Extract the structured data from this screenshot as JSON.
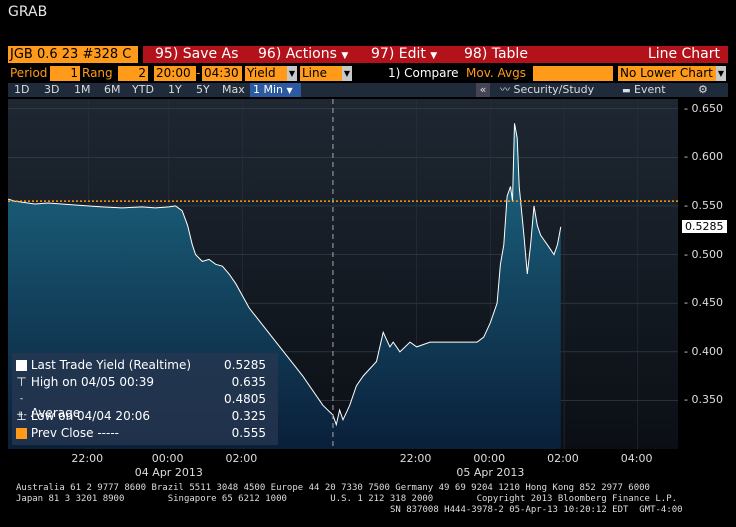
{
  "app": {
    "title": "GRAB"
  },
  "toolbar": {
    "ticker": "JGB 0.6 23 #328 C",
    "save_as": "95) Save As",
    "actions": "96) Actions",
    "edit": "97) Edit",
    "table": "98) Table",
    "chart_type": "Line Chart"
  },
  "params": {
    "period_label": "Period",
    "period_value": "1",
    "range_label": "Rang",
    "range_value": "2",
    "time_from": "20:00",
    "time_to": "04:30",
    "field_value": "Yield",
    "style_value": "Line",
    "compare": "1) Compare",
    "mov_avgs": "Mov. Avgs",
    "lower_chart": "No Lower Chart"
  },
  "periods": {
    "items": [
      "1D",
      "3D",
      "1M",
      "6M",
      "YTD",
      "1Y",
      "5Y",
      "Max"
    ],
    "selected": "1 Min",
    "collapse": "«",
    "security_study": "Security/Study",
    "event": "Event",
    "settings_glyph": "⚙"
  },
  "legend": {
    "last_trade_label": "Last Trade Yield (Realtime)",
    "last_trade_value": "0.5285",
    "high_label": "High on 04/05 00:39",
    "high_value": "0.635",
    "avg_label": "Average",
    "avg_value": "0.4805",
    "low_label": "Low on 04/04 20:06",
    "low_value": "0.325",
    "prev_label": "Prev Close -----",
    "prev_value": "0.555"
  },
  "footer": {
    "line1": "Australia 61 2 9777 8600 Brazil 5511 3048 4500 Europe 44 20 7330 7500 Germany 49 69 9204 1210 Hong Kong 852 2977 6000",
    "line2": "Japan 81 3 3201 8900        Singapore 65 6212 1000        U.S. 1 212 318 2000        Copyright 2013 Bloomberg Finance L.P.",
    "line3": "SN 837008 H444-3978-2 05-Apr-13 10:20:12 EDT  GMT-4:00"
  },
  "colors": {
    "accent_red": "#b3121b",
    "amber": "#ff9a1a",
    "area_top": "#1d6b86",
    "area_bottom": "#0a1f3a",
    "prev_close": "#ff9a1a"
  },
  "chart_data": {
    "type": "area",
    "ylim": [
      0.3,
      0.66
    ],
    "yticks": [
      "0.650",
      "0.600",
      "0.550",
      "0.500",
      "0.450",
      "0.400",
      "0.350"
    ],
    "ytick_values": [
      0.65,
      0.6,
      0.55,
      0.5,
      0.45,
      0.4,
      0.35
    ],
    "last_value_label": "0.5285",
    "last_value": 0.5285,
    "prev_close": 0.555,
    "xticks": [
      {
        "label": "22:00",
        "date": ""
      },
      {
        "label": "00:00",
        "date": "04 Apr 2013"
      },
      {
        "label": "02:00",
        "date": ""
      },
      {
        "label": "22:00",
        "date": ""
      },
      {
        "label": "00:00",
        "date": "05 Apr 2013"
      },
      {
        "label": "02:00",
        "date": ""
      },
      {
        "label": "04:00",
        "date": ""
      }
    ],
    "x_range": [
      0,
      100
    ],
    "xtick_positions": [
      12,
      24,
      35,
      61,
      72,
      83,
      94
    ],
    "session_break": 48.5,
    "series": [
      {
        "x": [
          0,
          1,
          4,
          6,
          8,
          10,
          14,
          17,
          20,
          22,
          24,
          25,
          26,
          26.8,
          27.5,
          28,
          29,
          30,
          31,
          32,
          33,
          34,
          36,
          40,
          44,
          47,
          48.5,
          49,
          49.5,
          50,
          51,
          52,
          53,
          55,
          56,
          57,
          57.5,
          58.5,
          60,
          61,
          63,
          66,
          69,
          70,
          71,
          72,
          73,
          73.5,
          74,
          74.5,
          75,
          75.3,
          75.6,
          76,
          76.3,
          77,
          77.5,
          78,
          78.5,
          79,
          79.5,
          80,
          80.5,
          81,
          81.5,
          82,
          82.5
        ],
        "y": [
          0.557,
          0.555,
          0.552,
          0.553,
          0.552,
          0.551,
          0.549,
          0.548,
          0.549,
          0.548,
          0.549,
          0.55,
          0.545,
          0.53,
          0.51,
          0.5,
          0.493,
          0.495,
          0.49,
          0.488,
          0.48,
          0.47,
          0.445,
          0.41,
          0.375,
          0.345,
          0.335,
          0.325,
          0.34,
          0.33,
          0.345,
          0.365,
          0.375,
          0.39,
          0.42,
          0.405,
          0.41,
          0.4,
          0.41,
          0.405,
          0.41,
          0.41,
          0.41,
          0.41,
          0.415,
          0.43,
          0.45,
          0.49,
          0.51,
          0.56,
          0.57,
          0.555,
          0.635,
          0.62,
          0.57,
          0.52,
          0.48,
          0.51,
          0.55,
          0.53,
          0.52,
          0.515,
          0.51,
          0.505,
          0.5,
          0.51,
          0.5285
        ]
      }
    ]
  }
}
